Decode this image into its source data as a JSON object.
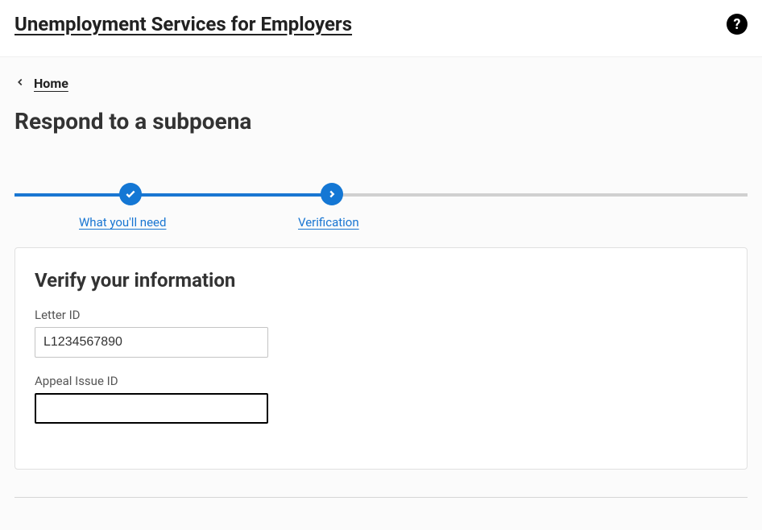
{
  "header": {
    "title": "Unemployment Services for Employers"
  },
  "breadcrumb": {
    "home": "Home"
  },
  "page": {
    "title": "Respond to a subpoena"
  },
  "stepper": {
    "steps": [
      {
        "label": "What you'll need"
      },
      {
        "label": "Verification"
      }
    ]
  },
  "form": {
    "title": "Verify your information",
    "fields": {
      "letter_id": {
        "label": "Letter ID",
        "value": "L1234567890"
      },
      "appeal_issue_id": {
        "label": "Appeal Issue ID",
        "value": ""
      }
    }
  }
}
